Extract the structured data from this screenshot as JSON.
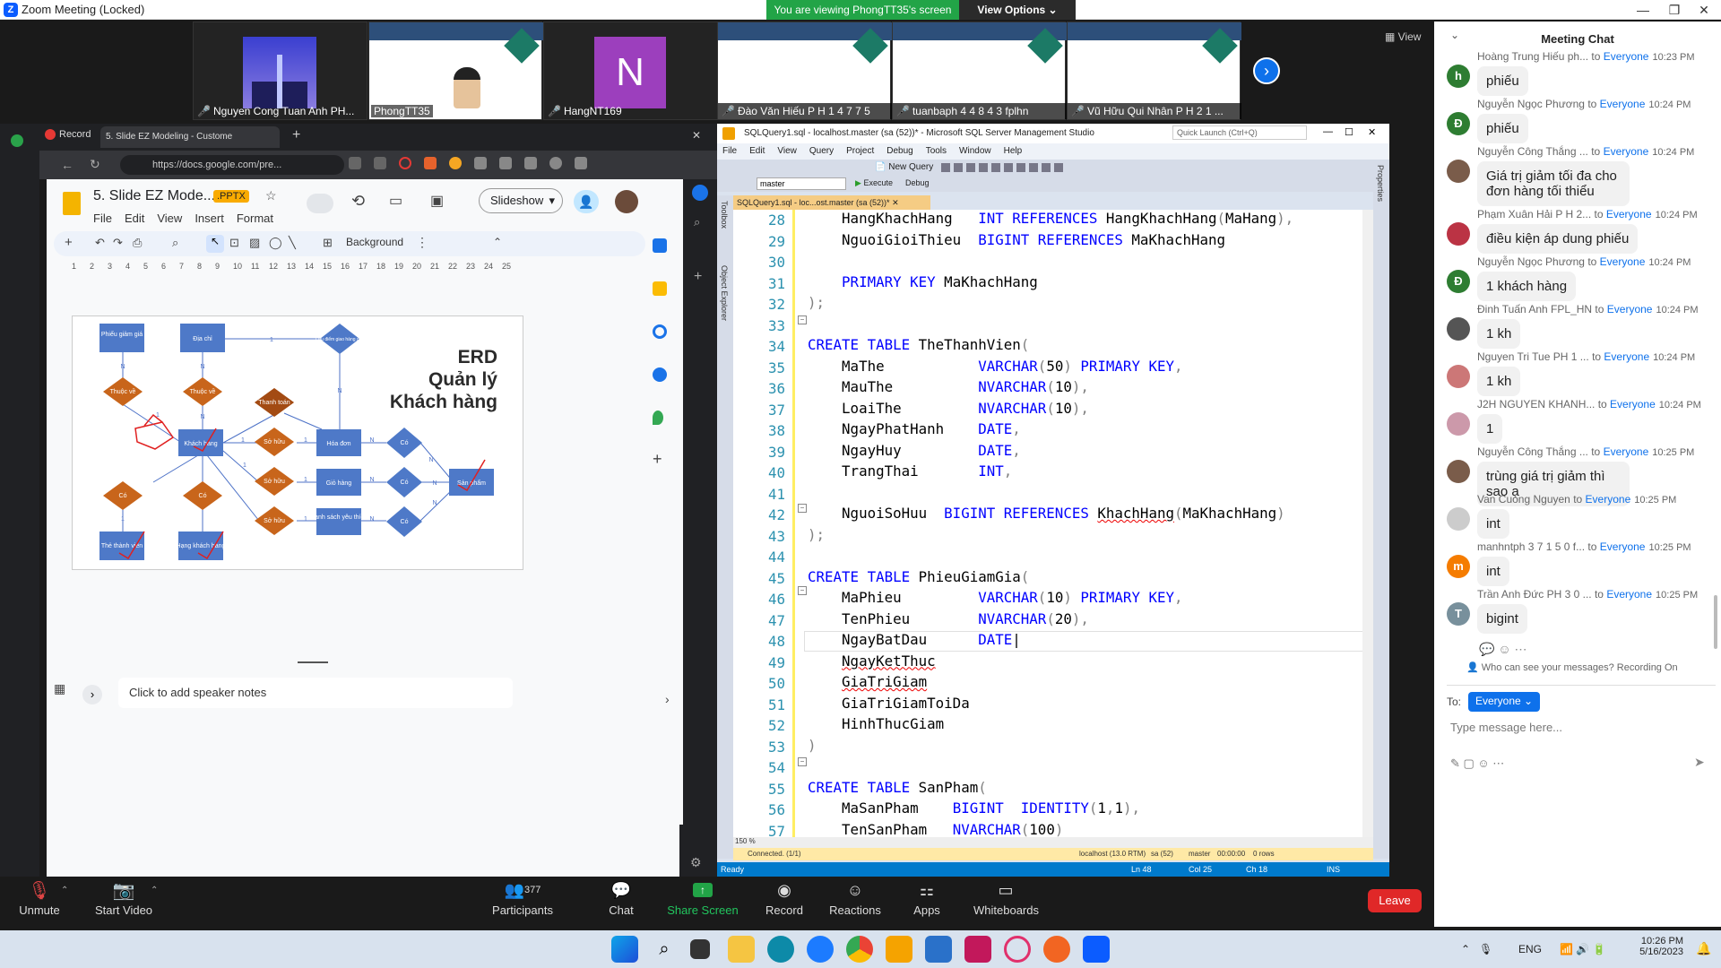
{
  "window": {
    "title": "Zoom Meeting (Locked)",
    "banner": "You are viewing PhongTT35's screen",
    "view_options": "View Options",
    "view_label": "View"
  },
  "participants": [
    {
      "name": "Nguyen Cong Tuan Anh PH..."
    },
    {
      "name": "PhongTT35"
    },
    {
      "name": "HangNT169",
      "initial": "N"
    },
    {
      "name": "Đào Văn Hiếu P H 1 4 7 7 5"
    },
    {
      "name": "tuanbaph 4 4 8 4 3 fplhn"
    },
    {
      "name": "Vũ Hữu Qui Nhân P H 2 1 ..."
    }
  ],
  "browser": {
    "tabs": [
      "Record",
      "5. Slide EZ Modeling - Custome"
    ],
    "url": "https://docs.google.com/pre...",
    "doc_title": "5. Slide EZ Mode...",
    "badge": ".PPTX",
    "menu": [
      "File",
      "Edit",
      "View",
      "Insert",
      "Format"
    ],
    "slideshow": "Slideshow",
    "background_btn": "Background",
    "ruler": [
      "1",
      "2",
      "3",
      "4",
      "5",
      "6",
      "7",
      "8",
      "9",
      "10",
      "11",
      "12",
      "13",
      "14",
      "15",
      "16",
      "17",
      "18",
      "19",
      "20",
      "21",
      "22",
      "23",
      "24",
      "25"
    ],
    "speaker_notes": "Click to add speaker notes"
  },
  "erd": {
    "title_lines": [
      "ERD",
      "Quản lý",
      "Khách hàng"
    ],
    "entities": [
      "Phiếu giảm giá",
      "Địa chỉ",
      "Khách hàng",
      "Hóa đơn",
      "Giỏ hàng",
      "Danh sách yêu thích",
      "Sản phẩm",
      "Thẻ thành viên",
      "Hạng khách hàng"
    ],
    "relations": [
      "Thuộc về",
      "Thuộc về",
      "Thanh toán",
      "Sở hữu",
      "Sở hữu",
      "Sở hữu",
      "Có",
      "Có",
      "Có",
      "Có",
      "Có",
      "Lưu điểm giao hàng của"
    ],
    "cardinality": [
      "N",
      "N",
      "1",
      "1",
      "N",
      "1",
      "1",
      "1",
      "N",
      "N",
      "N",
      "N",
      "1",
      "1",
      "1",
      "N",
      "N",
      "N"
    ]
  },
  "ssms": {
    "title": "SQLQuery1.sql - localhost.master (sa (52))* - Microsoft SQL Server Management Studio",
    "quick_launch": "Quick Launch (Ctrl+Q)",
    "menu": [
      "File",
      "Edit",
      "View",
      "Query",
      "Project",
      "Debug",
      "Tools",
      "Window",
      "Help"
    ],
    "new_query": "New Query",
    "database": "master",
    "execute": "Execute",
    "debug": "Debug",
    "tab": "SQLQuery1.sql - loc...ost.master (sa (52))*",
    "side_labels": [
      "Toolbox",
      "Object Explorer"
    ],
    "right_label": "Properties",
    "zoom": "150 %",
    "connected": "Connected. (1/1)",
    "server": "localhost (13.0 RTM)",
    "user": "sa (52)",
    "db": "master",
    "time": "00:00:00",
    "rows": "0 rows",
    "status": {
      "ready": "Ready",
      "ln": "Ln 48",
      "col": "Col 25",
      "ch": "Ch 18",
      "ins": "INS"
    },
    "line_numbers": [
      "28",
      "29",
      "30",
      "31",
      "32",
      "33",
      "34",
      "35",
      "36",
      "37",
      "38",
      "39",
      "40",
      "41",
      "42",
      "43",
      "44",
      "45",
      "46",
      "47",
      "48",
      "49",
      "50",
      "51",
      "52",
      "53",
      "54",
      "55",
      "56",
      "57"
    ]
  },
  "chat": {
    "title": "Meeting Chat",
    "messages": [
      {
        "sender": "Hoàng Trung Hiếu ph...",
        "to": "Everyone",
        "time": "10:23 PM",
        "text": "phiếu",
        "avatar": "h",
        "color": "#2e7d32"
      },
      {
        "sender": "Nguyễn Ngọc Phương",
        "to": "Everyone",
        "time": "10:24 PM",
        "text": "phiếu",
        "avatar": "Đ",
        "color": "#2e7d32"
      },
      {
        "sender": "Nguyễn Công Thắng ...",
        "to": "Everyone",
        "time": "10:24 PM",
        "text": "Giá trị giảm tối đa cho đơn hàng tối thiểu",
        "avatar": "",
        "color": "#7a5c4a"
      },
      {
        "sender": "Phạm Xuân Hải P H 2...",
        "to": "Everyone",
        "time": "10:24 PM",
        "text": "điều kiện áp dung phiếu",
        "avatar": "",
        "color": "#b34"
      },
      {
        "sender": "Nguyễn Ngọc Phương",
        "to": "Everyone",
        "time": "10:24 PM",
        "text": "1 khách hàng",
        "avatar": "Đ",
        "color": "#2e7d32"
      },
      {
        "sender": "Đinh Tuấn Anh FPL_HN",
        "to": "Everyone",
        "time": "10:24 PM",
        "text": "1 kh",
        "avatar": "",
        "color": "#555"
      },
      {
        "sender": "Nguyen Tri Tue PH 1 ...",
        "to": "Everyone",
        "time": "10:24 PM",
        "text": "1 kh",
        "avatar": "",
        "color": "#c77"
      },
      {
        "sender": "J2H NGUYEN KHANH...",
        "to": "Everyone",
        "time": "10:24 PM",
        "text": "1",
        "avatar": "",
        "color": "#c9a"
      },
      {
        "sender": "Nguyễn Công Thắng ...",
        "to": "Everyone",
        "time": "10:25 PM",
        "text": "trùng giá trị giảm thì sao ạ",
        "avatar": "",
        "color": "#7a5c4a"
      },
      {
        "sender": "Van Cuong Nguyen",
        "to": "Everyone",
        "time": "10:25 PM",
        "text": "int",
        "avatar": "",
        "color": "#ccc"
      },
      {
        "sender": "manhntph 3 7 1 5 0 f...",
        "to": "Everyone",
        "time": "10:25 PM",
        "text": "int",
        "avatar": "m",
        "color": "#f57c00"
      },
      {
        "sender": "Trần Anh Đức PH 3 0 ...",
        "to": "Everyone",
        "time": "10:25 PM",
        "text": "bigint",
        "avatar": "T",
        "color": "#78909c"
      }
    ],
    "who_can_see": "Who can see your messages? Recording On",
    "to_label": "To:",
    "to_value": "Everyone",
    "placeholder": "Type message here..."
  },
  "toolbar": {
    "unmute": "Unmute",
    "start_video": "Start Video",
    "participants": "Participants",
    "participant_count": "377",
    "chat": "Chat",
    "share": "Share Screen",
    "record": "Record",
    "reactions": "Reactions",
    "apps": "Apps",
    "whiteboards": "Whiteboards",
    "leave": "Leave"
  },
  "taskbar": {
    "lang": "ENG",
    "time": "10:26 PM",
    "date": "5/16/2023"
  }
}
